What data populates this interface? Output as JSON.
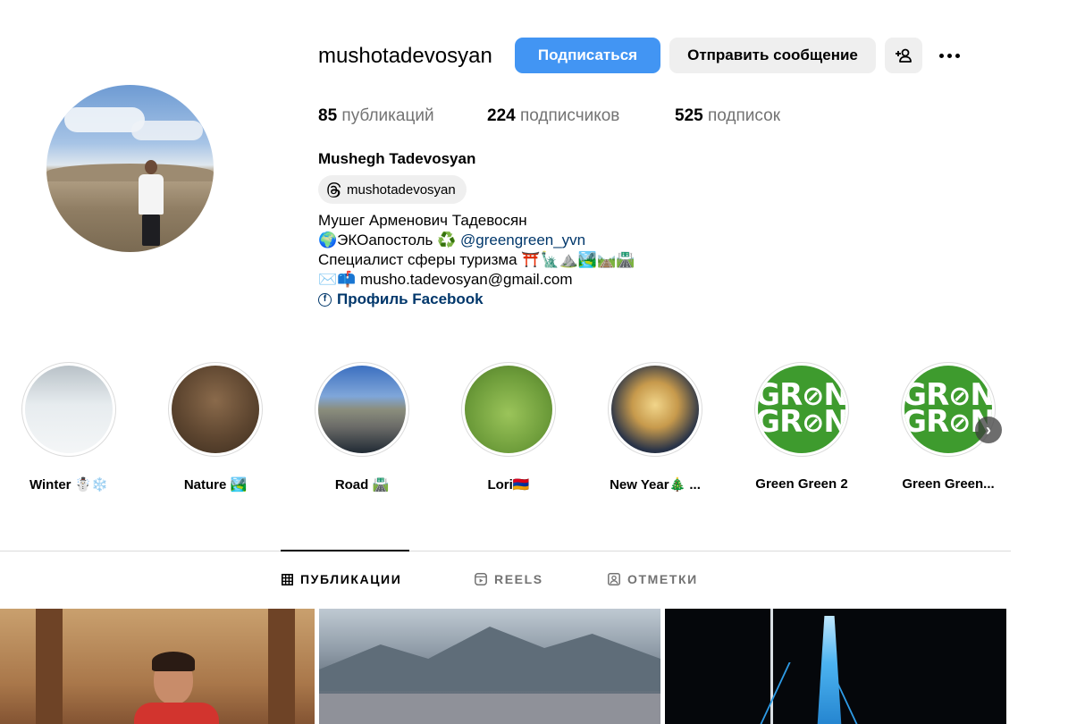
{
  "profile": {
    "username": "mushotadevosyan",
    "full_name": "Mushegh Tadevosyan",
    "threads_handle": "mushotadevosyan"
  },
  "actions": {
    "follow_label": "Подписаться",
    "message_label": "Отправить сообщение"
  },
  "stats": {
    "posts_count": "85",
    "posts_label": "публикаций",
    "followers_count": "224",
    "followers_label": "подписчиков",
    "following_count": "525",
    "following_label": "подписок"
  },
  "bio": {
    "line1": "Мушег Арменович Тадевосян",
    "line2_prefix": "🌍ЭКОапостоль ♻️ ",
    "line2_mention": "@greengreen_yvn",
    "line3": "Специалист сферы туризма ⛩️🗽⛰️🏞️🛤️🛣️",
    "line4": "✉️📫 musho.tadevosyan@gmail.com",
    "facebook_label": "Профиль Facebook"
  },
  "highlights": [
    {
      "label": "Winter ☃️❄️"
    },
    {
      "label": "Nature 🏞️"
    },
    {
      "label": "Road 🛣️"
    },
    {
      "label": "Lori🇦🇲"
    },
    {
      "label": "New Year🎄 ..."
    },
    {
      "label": "Green Green 2"
    },
    {
      "label": "Green Green..."
    }
  ],
  "green_logo_text": "GR N\nGR N",
  "tabs": [
    {
      "label": "ПУБЛИКАЦИИ",
      "icon": "grid-icon",
      "active": true
    },
    {
      "label": "REELS",
      "icon": "reels-icon",
      "active": false
    },
    {
      "label": "ОТМЕТКИ",
      "icon": "tagged-icon",
      "active": false
    }
  ],
  "colors": {
    "primary_button": "#4295f3",
    "secondary_button": "#efefef",
    "link": "#00376b",
    "muted_text": "#737373",
    "highlight_green": "#3e9b2e"
  }
}
